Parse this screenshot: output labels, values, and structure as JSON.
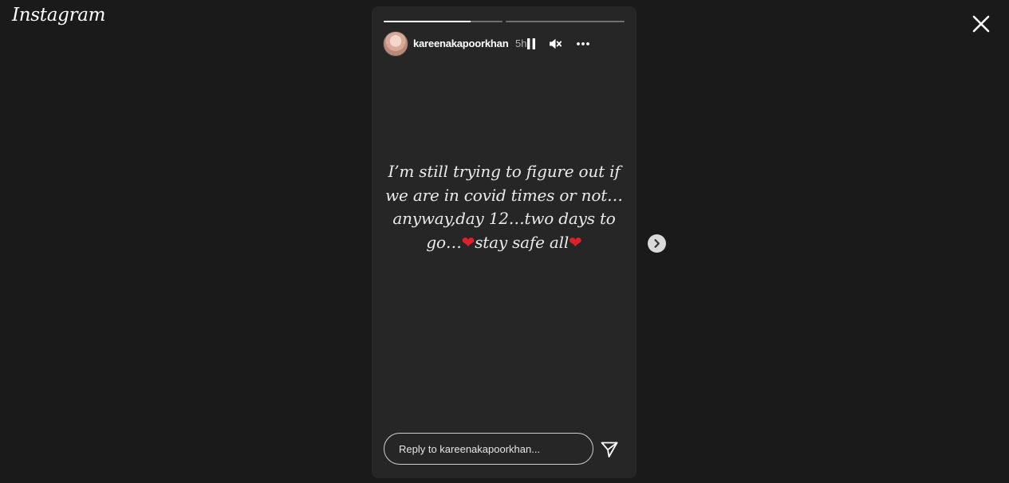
{
  "app": {
    "logo_text": "Instagram"
  },
  "story": {
    "username": "kareenakapoorkhan",
    "time_ago": "5h",
    "progress": [
      {
        "fill_percent": 73
      },
      {
        "fill_percent": 0
      }
    ],
    "text_lines": [
      "I’m still trying to figure out if",
      "we are in covid times or not…",
      "anyway,day 12…two days to",
      "go…",
      "stay safe all"
    ],
    "heart_glyph": "❤"
  },
  "reply": {
    "placeholder": "Reply to kareenakapoorkhan..."
  },
  "icons": {
    "close": "close-icon",
    "pause": "pause-icon",
    "mute": "muted-speaker-icon",
    "more": "more-options-icon",
    "send": "send-icon",
    "next": "chevron-right-icon"
  },
  "colors": {
    "page_background": "#1a1a1a",
    "story_background": "#262626",
    "heart": "#e0202a"
  }
}
